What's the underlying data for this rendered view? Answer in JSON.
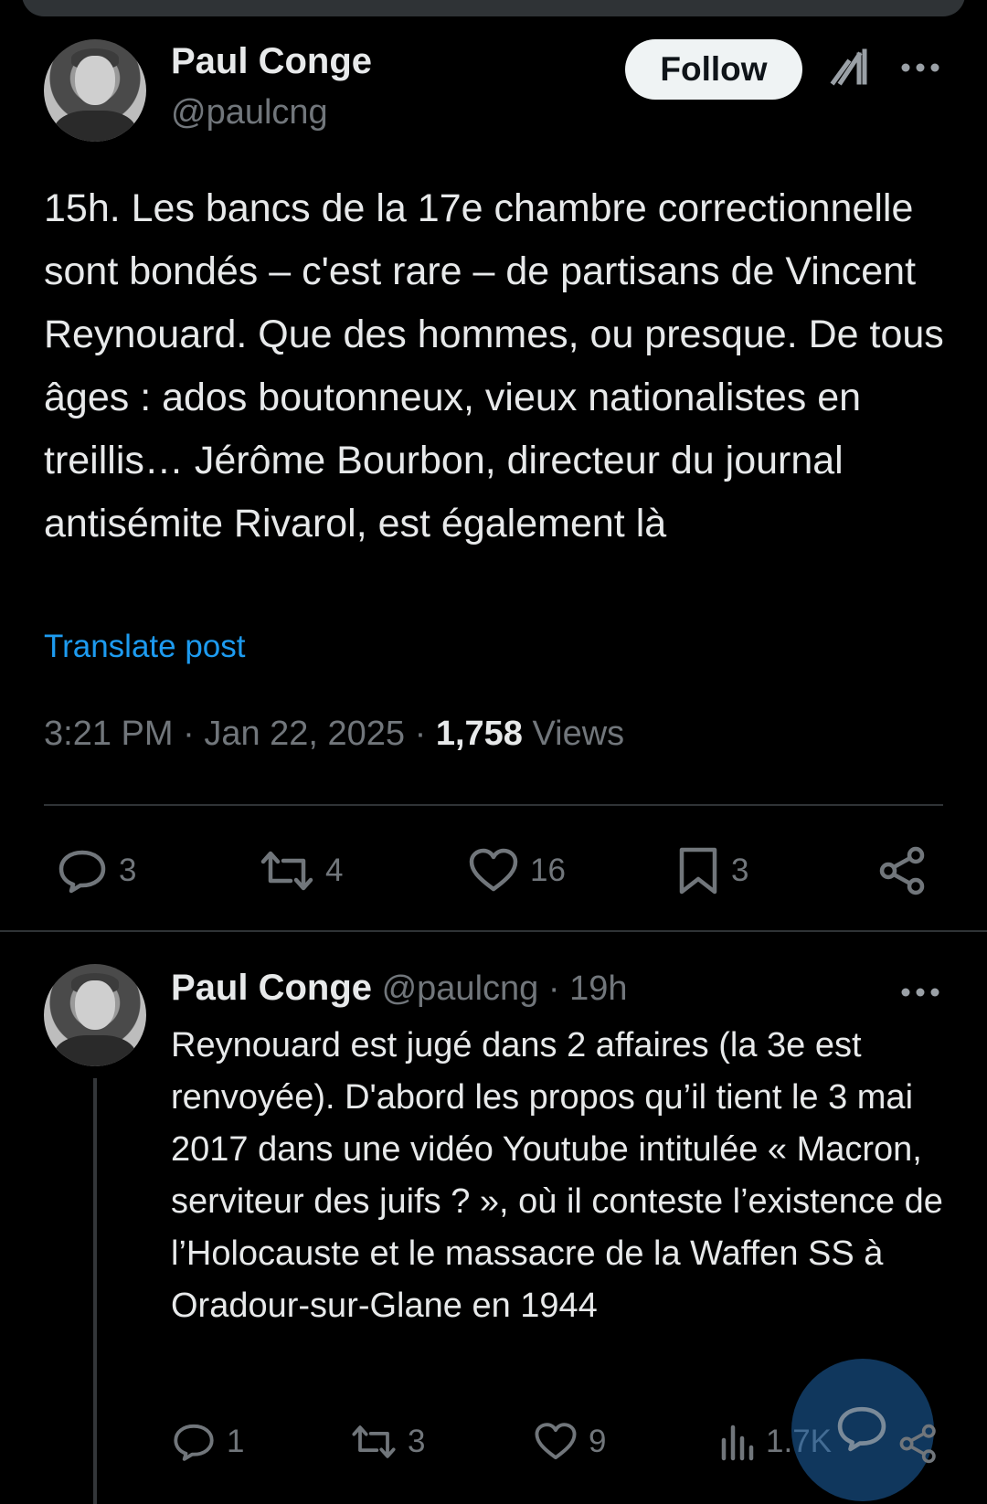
{
  "post": {
    "author_name": "Paul Conge",
    "author_handle": "@paulcng",
    "follow_label": "Follow",
    "text": "15h. Les bancs de la 17e chambre correctionnelle sont bondés – c'est rare – de partisans de Vincent Reynouard. Que des hommes, ou presque. De tous âges :  ados boutonneux, vieux nationalistes en treillis… Jérôme Bourbon, directeur du journal antisémite Rivarol, est également là",
    "translate_label": "Translate post",
    "time": "3:21 PM",
    "date": "Jan 22, 2025",
    "views_count": "1,758",
    "views_label": "Views",
    "actions": {
      "replies": "3",
      "reposts": "4",
      "likes": "16",
      "bookmarks": "3"
    }
  },
  "reply": {
    "author_name": "Paul Conge",
    "author_handle": "@paulcng",
    "age": "19h",
    "text": "Reynouard est jugé dans 2 affaires (la 3e est renvoyée). D'abord les propos qu’il tient le 3 mai 2017 dans une vidéo Youtube intitulée « Macron, serviteur des juifs ? », où il conteste l’existence de l’Holocauste et le massacre de la Waffen SS à Oradour-sur-Glane en 1944",
    "actions": {
      "replies": "1",
      "reposts": "3",
      "likes": "9",
      "views": "1.7K"
    }
  },
  "icons": {
    "grok": "grok-icon",
    "more": "more-icon",
    "reply": "reply-icon",
    "repost": "repost-icon",
    "like": "like-icon",
    "bookmark": "bookmark-icon",
    "share": "share-icon",
    "analytics": "analytics-icon",
    "compose": "compose-reply-icon"
  },
  "colors": {
    "background": "#000000",
    "text": "#e7e9ea",
    "muted": "#71767b",
    "link": "#1d9bf0",
    "follow_bg": "#eff3f4"
  }
}
